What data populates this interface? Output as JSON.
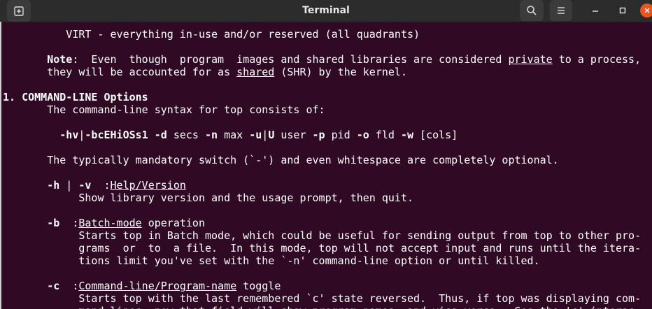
{
  "window": {
    "title": "Terminal",
    "icons": {
      "new_tab": "new-tab-icon",
      "search": "search-icon",
      "menu": "hamburger-menu-icon",
      "minimize": "minimize-icon",
      "maximize": "maximize-icon",
      "close": "close-icon"
    },
    "colors": {
      "terminal_bg": "#300a24",
      "titlebar_bg": "#2c2c2c",
      "close_accent": "#e95420",
      "text": "#ffffff"
    }
  },
  "terminal": {
    "lines": [
      [
        {
          "t": "          VIRT - everything in-use and/or reserved (all quadrants)"
        }
      ],
      [],
      [
        {
          "t": "       "
        },
        {
          "t": "Note",
          "b": true
        },
        {
          "t": ":  Even  though  program  images and shared libraries are considered "
        },
        {
          "t": "private",
          "u": true
        },
        {
          "t": " to a process,"
        }
      ],
      [
        {
          "t": "       they will be accounted for as "
        },
        {
          "t": "shared",
          "u": true
        },
        {
          "t": " (SHR) by the kernel."
        }
      ],
      [],
      [
        {
          "t": "1. COMMAND-LINE Options",
          "b": true
        }
      ],
      [
        {
          "t": "       The command-line syntax for top consists of:"
        }
      ],
      [],
      [
        {
          "t": "         "
        },
        {
          "t": "-hv",
          "b": true
        },
        {
          "t": "|"
        },
        {
          "t": "-bcEHiOSs1",
          "b": true
        },
        {
          "t": " "
        },
        {
          "t": "-d",
          "b": true
        },
        {
          "t": " secs "
        },
        {
          "t": "-n",
          "b": true
        },
        {
          "t": " max "
        },
        {
          "t": "-u",
          "b": true
        },
        {
          "t": "|"
        },
        {
          "t": "U",
          "b": true
        },
        {
          "t": " user "
        },
        {
          "t": "-p",
          "b": true
        },
        {
          "t": " pid "
        },
        {
          "t": "-o",
          "b": true
        },
        {
          "t": " fld "
        },
        {
          "t": "-w",
          "b": true
        },
        {
          "t": " [cols]"
        }
      ],
      [],
      [
        {
          "t": "       The typically mandatory switch (`-') and even whitespace are completely optional."
        }
      ],
      [],
      [
        {
          "t": "       "
        },
        {
          "t": "-h",
          "b": true
        },
        {
          "t": " | "
        },
        {
          "t": "-v",
          "b": true
        },
        {
          "t": "  :"
        },
        {
          "t": "Help/Version",
          "u": true
        }
      ],
      [
        {
          "t": "            Show library version and the usage prompt, then quit."
        }
      ],
      [],
      [
        {
          "t": "       "
        },
        {
          "t": "-b",
          "b": true
        },
        {
          "t": "  :"
        },
        {
          "t": "Batch-mode",
          "u": true
        },
        {
          "t": " operation"
        }
      ],
      [
        {
          "t": "            Starts top in Batch mode, which could be useful for sending output from top to other pro-"
        }
      ],
      [
        {
          "t": "            grams  or  to  a file.  In this mode, top will not accept input and runs until the itera-"
        }
      ],
      [
        {
          "t": "            tions limit you've set with the `-n' command-line option or until killed."
        }
      ],
      [],
      [
        {
          "t": "       "
        },
        {
          "t": "-c",
          "b": true
        },
        {
          "t": "  :"
        },
        {
          "t": "Command-line/Program-name",
          "u": true
        },
        {
          "t": " toggle"
        }
      ],
      [
        {
          "t": "            Starts top with the last remembered `c' state reversed.  Thus, if top was displaying com-"
        }
      ],
      [
        {
          "t": "            mand lines, now that field will show program names, and visa versa.  See the 'c' interac-"
        }
      ]
    ]
  }
}
